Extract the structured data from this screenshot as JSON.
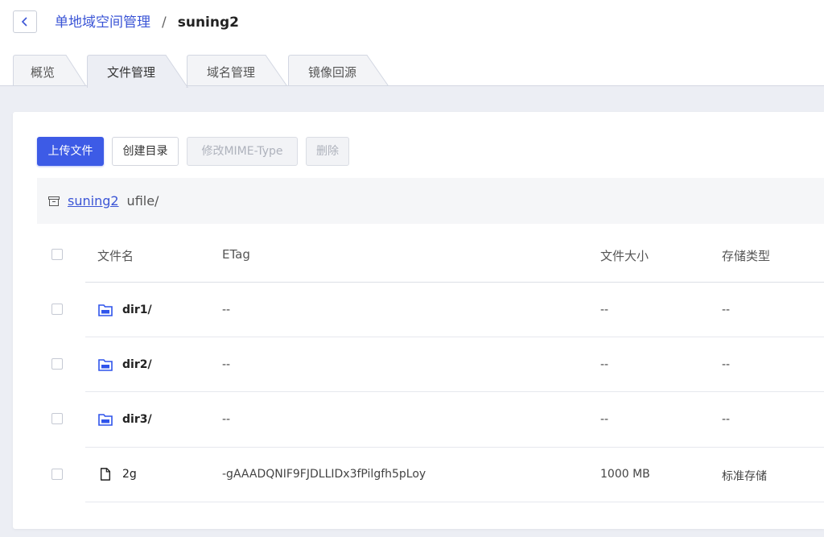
{
  "header": {
    "back_icon": "chevron-left-icon",
    "breadcrumb_parent": "单地域空间管理",
    "breadcrumb_separator": "/",
    "breadcrumb_current": "suning2"
  },
  "tabs": [
    {
      "label": "概览",
      "active": false
    },
    {
      "label": "文件管理",
      "active": true
    },
    {
      "label": "域名管理",
      "active": false
    },
    {
      "label": "镜像回源",
      "active": false
    }
  ],
  "toolbar": {
    "upload_label": "上传文件",
    "mkdir_label": "创建目录",
    "mime_label": "修改MIME-Type",
    "delete_label": "删除"
  },
  "path": {
    "icon": "bucket-icon",
    "bucket": "suning2",
    "prefix": "ufile/"
  },
  "table": {
    "columns": [
      "文件名",
      "ETag",
      "文件大小",
      "存储类型"
    ],
    "rows": [
      {
        "icon": "folder-icon",
        "name": "dir1/",
        "etag": "--",
        "size": "--",
        "storage": "--"
      },
      {
        "icon": "folder-icon",
        "name": "dir2/",
        "etag": "--",
        "size": "--",
        "storage": "--"
      },
      {
        "icon": "folder-icon",
        "name": "dir3/",
        "etag": "--",
        "size": "--",
        "storage": "--"
      },
      {
        "icon": "file-icon",
        "name": "2g",
        "etag": "-gAAADQNIF9FJDLLIDx3fPilgfh5pLoy",
        "size": "1000 MB",
        "storage": "标准存储"
      }
    ]
  },
  "colors": {
    "accent": "#3d5be6",
    "link": "#3b55d6",
    "page_bg": "#eceef4",
    "folder_icon": "#2f54eb"
  }
}
